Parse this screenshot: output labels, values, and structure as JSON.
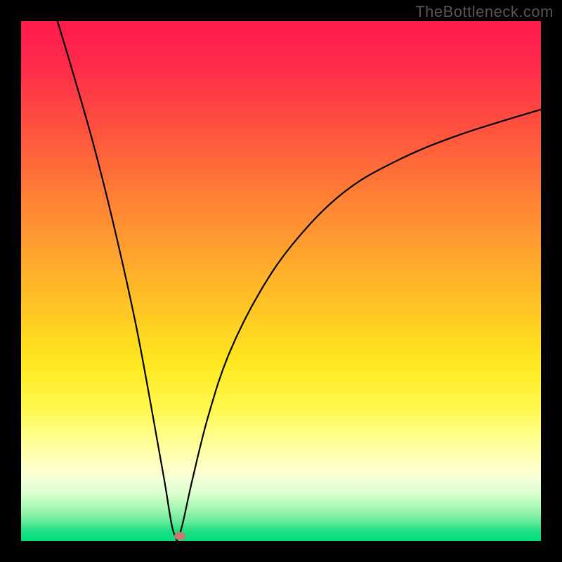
{
  "watermark": "TheBottleneck.com",
  "chart_data": {
    "type": "line",
    "title": "",
    "xlabel": "",
    "ylabel": "",
    "xlim": [
      0,
      100
    ],
    "ylim": [
      0,
      100
    ],
    "background": "rainbow-gradient (red top → green bottom)",
    "curve": {
      "description": "V-shaped bottleneck curve; steep descent from top-left to a minimum near x≈30, then rising asymptotically toward the right",
      "min_x": 30,
      "min_y": 0,
      "points": [
        {
          "x": 7,
          "y": 100
        },
        {
          "x": 10,
          "y": 90
        },
        {
          "x": 14,
          "y": 76
        },
        {
          "x": 18,
          "y": 60
        },
        {
          "x": 22,
          "y": 42
        },
        {
          "x": 25,
          "y": 26
        },
        {
          "x": 27.5,
          "y": 12
        },
        {
          "x": 29,
          "y": 3
        },
        {
          "x": 30,
          "y": 0
        },
        {
          "x": 31,
          "y": 3
        },
        {
          "x": 33,
          "y": 12
        },
        {
          "x": 36,
          "y": 24
        },
        {
          "x": 40,
          "y": 36
        },
        {
          "x": 46,
          "y": 48
        },
        {
          "x": 53,
          "y": 58
        },
        {
          "x": 62,
          "y": 67
        },
        {
          "x": 72,
          "y": 73
        },
        {
          "x": 84,
          "y": 78
        },
        {
          "x": 100,
          "y": 83
        }
      ]
    },
    "marker": {
      "x": 30.5,
      "y": 1,
      "color": "#c77a6f"
    }
  }
}
